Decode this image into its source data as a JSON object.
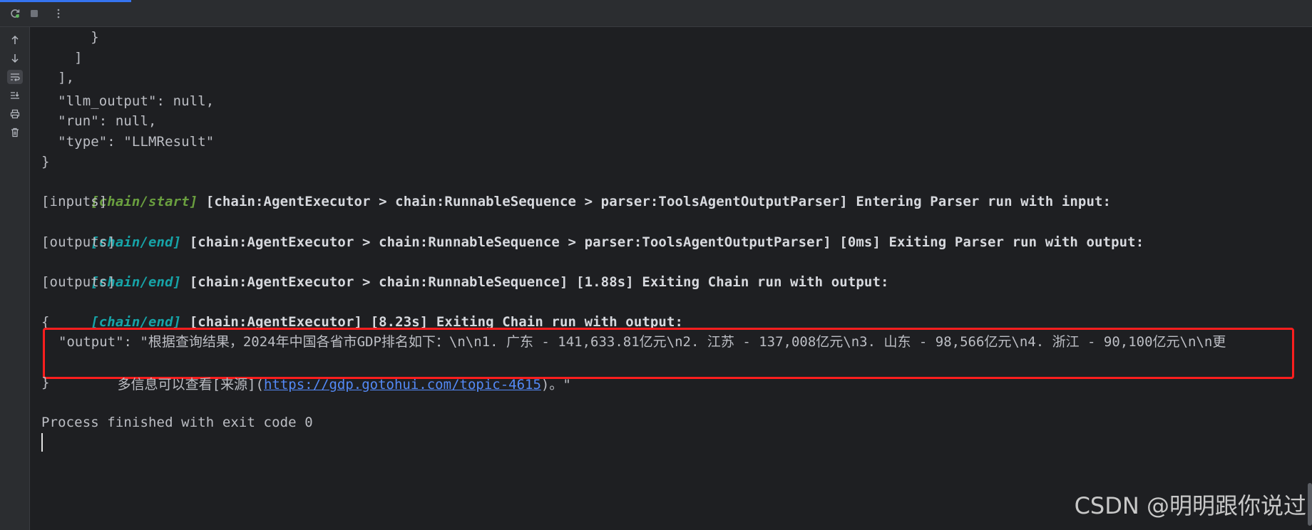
{
  "toolbar": {
    "rerun_icon": "rerun-icon",
    "stop_icon": "stop-icon",
    "more_icon": "more-icon"
  },
  "side_toolbar": {
    "icons": [
      "arrow-up-icon",
      "arrow-down-icon",
      "soft-wrap-icon",
      "scroll-to-end-icon",
      "print-icon",
      "trash-icon"
    ]
  },
  "console": {
    "lines": {
      "l0": "      }",
      "l1": "    ]",
      "l2": "  ],",
      "l3": "  \"llm_output\": null,",
      "l4": "  \"run\": null,",
      "l5": "  \"type\": \"LLMResult\"",
      "l6": "}",
      "l7_tag": "[chain/start]",
      "l7_text": " [chain:AgentExecutor > chain:RunnableSequence > parser:ToolsAgentOutputParser] Entering Parser run with input:",
      "l8": "[inputs]",
      "l9_tag": "[chain/end]",
      "l9_text": " [chain:AgentExecutor > chain:RunnableSequence > parser:ToolsAgentOutputParser] [0ms] Exiting Parser run with output:",
      "l10": "[outputs]",
      "l11_tag": "[chain/end]",
      "l11_text": " [chain:AgentExecutor > chain:RunnableSequence] [1.88s] Exiting Chain run with output:",
      "l12": "[outputs]",
      "l13_tag": "[chain/end]",
      "l13_text": " [chain:AgentExecutor] [8.23s] Exiting Chain run with output:",
      "l14": "{",
      "out1": "\"output\": \"根据查询结果，2024年中国各省市GDP排名如下：\\n\\n1. 广东 - 141,633.81亿元\\n2. 江苏 - 137,008亿元\\n3. 山东 - 98,566亿元\\n4. 浙江 - 90,100亿元\\n\\n更",
      "out2_pre": "多信息可以查看[来源](",
      "out2_link": "https://gdp.gotohui.com/topic-4615",
      "out2_post": ")。\"",
      "l15": "}",
      "l16": "Process finished with exit code 0"
    }
  },
  "watermark": "CSDN @明明跟你说过",
  "colors": {
    "background": "#1e1f22",
    "tag_start": "#6a9f3f",
    "tag_end": "#16a4a8",
    "highlight_border": "#ff1e1e",
    "link": "#548af7"
  }
}
